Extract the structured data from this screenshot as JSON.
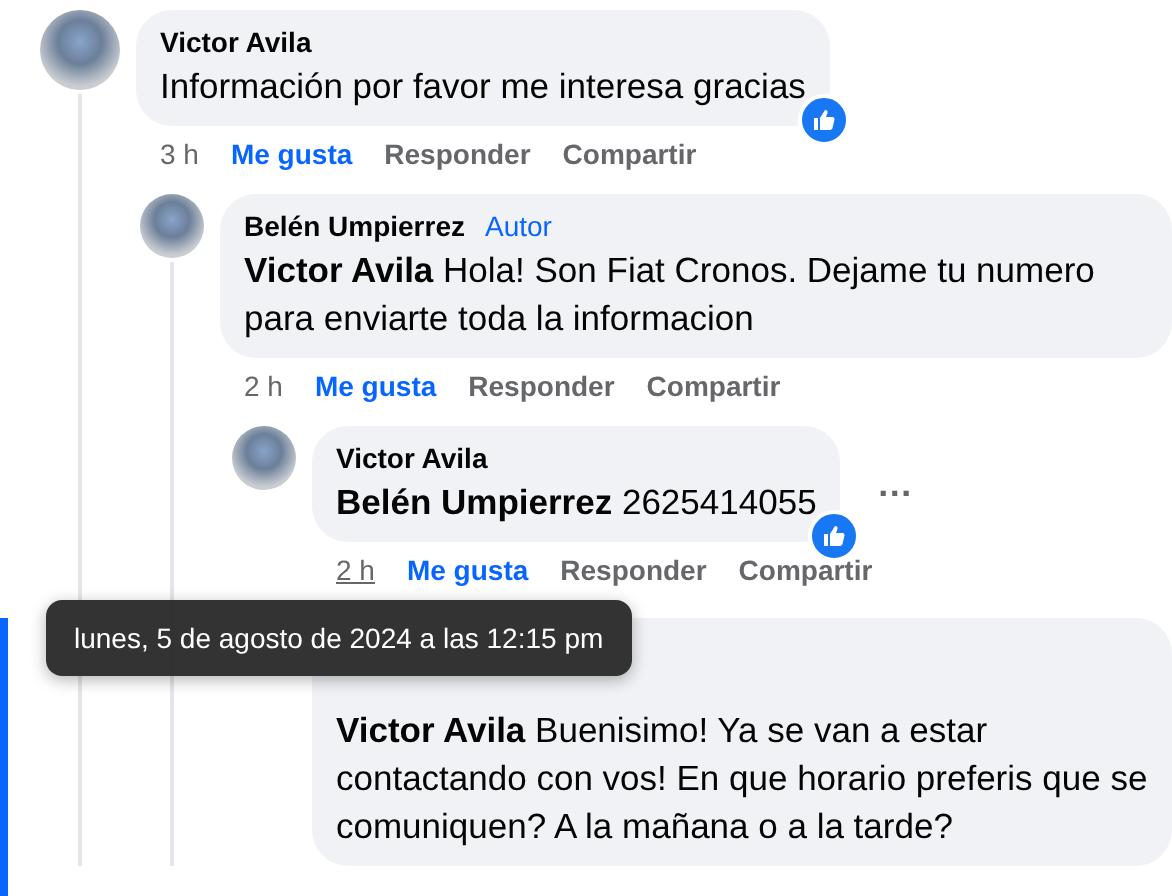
{
  "comments": [
    {
      "author": "Victor Avila",
      "text": "Información por favor me interesa gracias",
      "reacted": true,
      "time": "3 h",
      "time_hovered": false,
      "liked": true,
      "actions": [
        "Me gusta",
        "Responder",
        "Compartir"
      ],
      "children": [
        {
          "author": "Belén Umpierrez",
          "badge": "Autor",
          "text": "**Victor Avila** Hola! Son Fiat Cronos. Dejame tu numero para enviarte toda la informacion",
          "reacted": false,
          "time": "2 h",
          "time_hovered": false,
          "liked": true,
          "actions": [
            "Me gusta",
            "Responder",
            "Compartir"
          ],
          "children": [
            {
              "author": "Victor Avila",
              "text": "**Belén Umpierrez** 2625414055",
              "reacted": true,
              "time": "2 h",
              "time_hovered": true,
              "liked": true,
              "actions": [
                "Me gusta",
                "Responder",
                "Compartir"
              ],
              "more_button": "…"
            },
            {
              "text": "**Victor Avila** Buenisimo! Ya se van a estar contactando con vos! En que horario preferis que se comuniquen? A la mañana o a la tarde?",
              "reacted": false,
              "highlighted": true
            }
          ]
        }
      ]
    }
  ],
  "tooltip": {
    "text": "lunes, 5 de agosto de 2024 a las 12:15 pm"
  }
}
